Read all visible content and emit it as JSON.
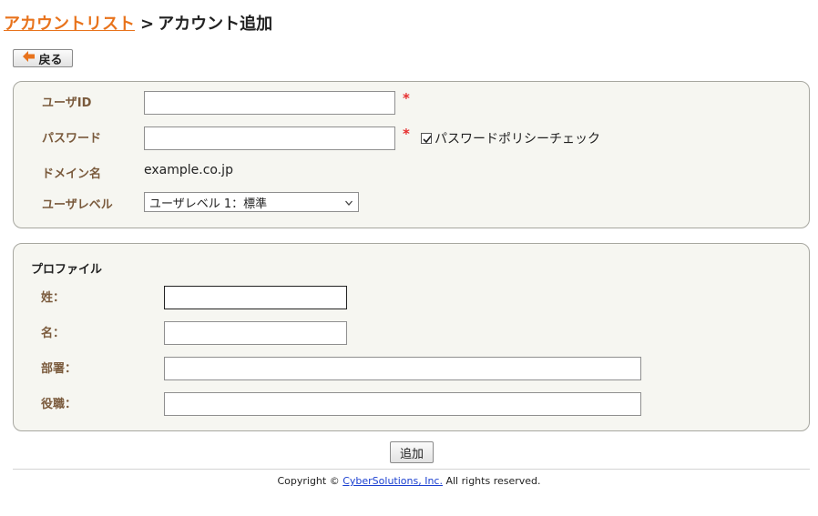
{
  "breadcrumb": {
    "parent": "アカウントリスト",
    "separator": ">",
    "current": "アカウント追加"
  },
  "back_button": {
    "label": "戻る",
    "icon": "arrow-left-icon",
    "icon_color": "#e8731c"
  },
  "account": {
    "user_id_label": "ユーザID",
    "user_id_value": "",
    "password_label": "パスワード",
    "password_value": "",
    "required_mark": "*",
    "policy_check_label": "パスワードポリシーチェック",
    "policy_check_checked": true,
    "domain_label": "ドメイン名",
    "domain_value": "example.co.jp",
    "user_level_label": "ユーザレベル",
    "user_level_selected": "ユーザレベル 1：標準"
  },
  "profile": {
    "title": "プロファイル",
    "last_name_label": "姓：",
    "last_name_value": "",
    "first_name_label": "名：",
    "first_name_value": "",
    "department_label": "部署：",
    "department_value": "",
    "position_label": "役職：",
    "position_value": ""
  },
  "submit_label": "追加",
  "footer": {
    "prefix": "Copyright © ",
    "company": "CyberSolutions, Inc.",
    "suffix": " All rights reserved."
  },
  "colors": {
    "link": "#e8731c",
    "label": "#7a5a3c",
    "required": "#e62e2e",
    "panel_bg": "#f6f6f1"
  }
}
